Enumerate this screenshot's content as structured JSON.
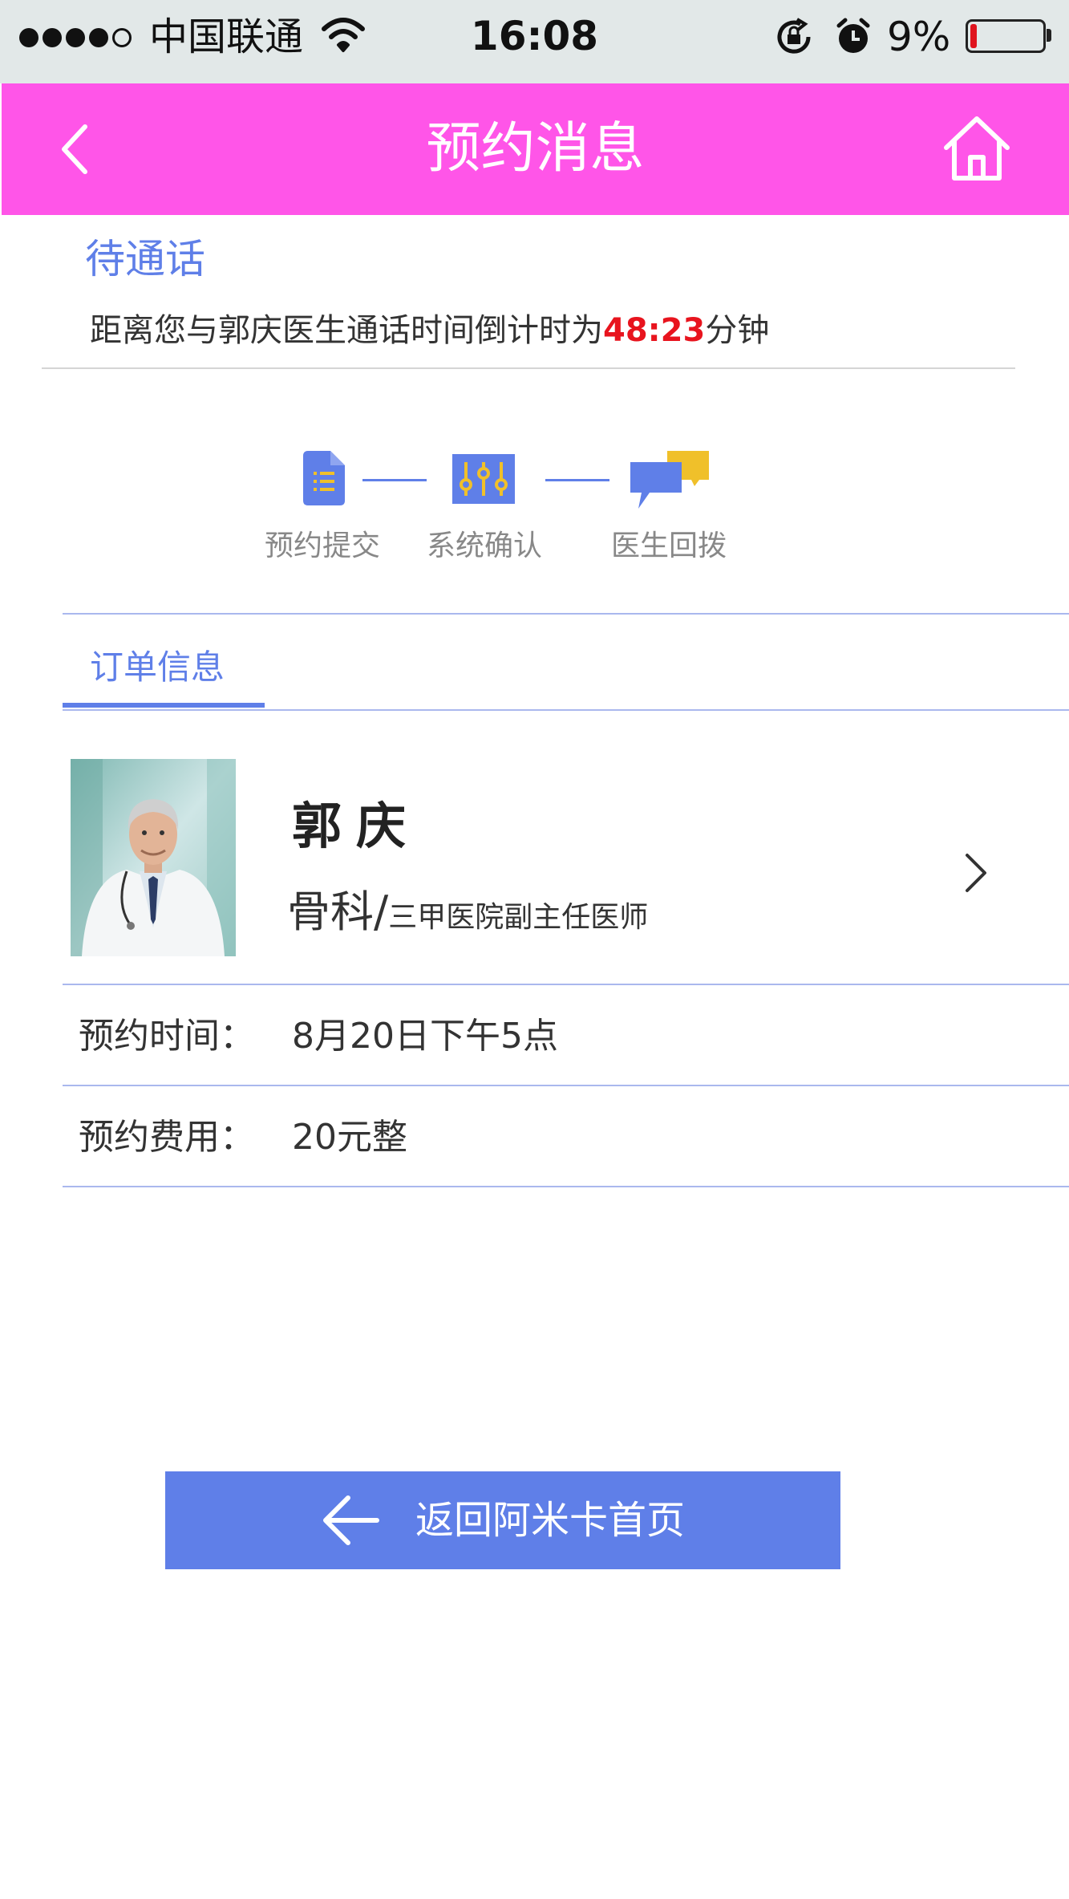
{
  "colors": {
    "status_bar_bg": "#e2e8e8",
    "nav_bg": "#ff55e8",
    "accent_blue": "#5f7fe8",
    "divider_blue": "#aab8ee",
    "countdown_red": "#e8141e",
    "icon_yellow": "#f0c02a"
  },
  "status_bar": {
    "carrier": "中国联通",
    "time": "16:08",
    "battery_percent": "9%",
    "battery_level": 0.09,
    "signal_bars_filled": 4,
    "signal_bars_total": 5
  },
  "nav": {
    "title": "预约消息",
    "back_icon": "chevron-left-icon",
    "home_icon": "home-icon"
  },
  "waiting": {
    "title": "待通话",
    "desc_prefix": "距离您与郭庆医生通话时间倒计时为",
    "countdown": "48:23",
    "desc_suffix": "分钟"
  },
  "steps": [
    {
      "label": "预约提交",
      "icon": "document-icon"
    },
    {
      "label": "系统确认",
      "icon": "sliders-icon"
    },
    {
      "label": "医生回拨",
      "icon": "chat-bubbles-icon"
    }
  ],
  "order": {
    "tab_label": "订单信息",
    "doctor": {
      "name": "郭庆",
      "department": "骨科",
      "separator": "/",
      "title": "三甲医院副主任医师"
    },
    "rows": [
      {
        "label": "预约时间：",
        "value": "8月20日下午5点"
      },
      {
        "label": "预约费用：",
        "value": "20元整"
      }
    ]
  },
  "return_button": {
    "label": "返回阿米卡首页",
    "icon": "arrow-left-icon"
  }
}
